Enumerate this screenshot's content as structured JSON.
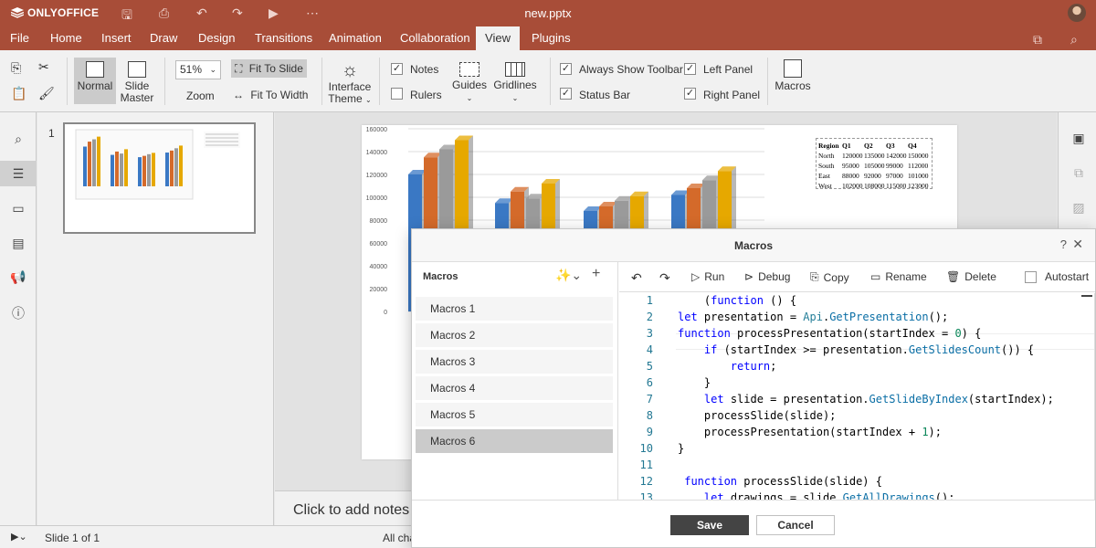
{
  "app": {
    "logo_text": "ONLYOFFICE",
    "doc_title": "new.pptx"
  },
  "menu": {
    "items": [
      "File",
      "Home",
      "Insert",
      "Draw",
      "Design",
      "Transitions",
      "Animation",
      "Collaboration",
      "View",
      "Plugins"
    ],
    "active": "View"
  },
  "toolbar": {
    "normal_label": "Normal",
    "slide_master_label": [
      "Slide",
      "Master"
    ],
    "zoom_value": "51%",
    "zoom_label": "Zoom",
    "fit_to_slide": "Fit To Slide",
    "fit_to_width": "Fit To Width",
    "interface_theme": [
      "Interface",
      "Theme"
    ],
    "notes": "Notes",
    "rulers": "Rulers",
    "guides": "Guides",
    "gridlines": "Gridlines",
    "always_show_toolbar": "Always Show Toolbar",
    "status_bar": "Status Bar",
    "left_panel": "Left Panel",
    "right_panel": "Right Panel",
    "macros": "Macros",
    "checks": {
      "notes": true,
      "rulers": false,
      "always_show_toolbar": true,
      "status_bar": true,
      "left_panel": true,
      "right_panel": true
    }
  },
  "thumbnail": {
    "number": "1"
  },
  "slide": {
    "chart": {
      "y_ticks": [
        "160000",
        "140000",
        "120000",
        "100000",
        "80000",
        "60000",
        "40000",
        "20000",
        "0"
      ],
      "groups": [
        [
          120000,
          135000,
          142000,
          150000
        ],
        [
          95000,
          105000,
          99000,
          112000
        ],
        [
          88000,
          92000,
          97000,
          101000
        ],
        [
          102000,
          108000,
          115000,
          123000
        ]
      ],
      "colors": [
        "#3a78c4",
        "#d46a2a",
        "#9a9a9a",
        "#e6a800"
      ],
      "ylim": [
        0,
        160000
      ]
    },
    "table": {
      "header": [
        "Region",
        "Q1",
        "Q2",
        "Q3",
        "Q4"
      ],
      "rows": [
        [
          "North",
          "120000",
          "135000",
          "142000",
          "150000"
        ],
        [
          "South",
          "95000",
          "105000",
          "99000",
          "112000"
        ],
        [
          "East",
          "88000",
          "92000",
          "97000",
          "101000"
        ],
        [
          "West",
          "102000",
          "108000",
          "115000",
          "123000"
        ]
      ]
    }
  },
  "notes_placeholder": "Click to add notes",
  "status": {
    "slide_info": "Slide 1 of 1",
    "changes": "All cha"
  },
  "dialog": {
    "title": "Macros",
    "left_title": "Macros",
    "macros": [
      "Macros 1",
      "Macros 2",
      "Macros 3",
      "Macros 4",
      "Macros 5",
      "Macros 6"
    ],
    "selected": "Macros 6",
    "tools": {
      "run": "Run",
      "debug": "Debug",
      "copy": "Copy",
      "rename": "Rename",
      "delete": "Delete",
      "autostart": "Autostart"
    },
    "line_numbers": [
      "1",
      "2",
      "3",
      "4",
      "5",
      "6",
      "7",
      "8",
      "9",
      "10",
      "11",
      "12",
      "13"
    ],
    "code": [
      "    (function () {",
      "let presentation = Api.GetPresentation();",
      "function processPresentation(startIndex = 0) {",
      "    if (startIndex >= presentation.GetSlidesCount()) {",
      "        return;",
      "    }",
      "    let slide = presentation.GetSlideByIndex(startIndex);",
      "    processSlide(slide);",
      "    processPresentation(startIndex + 1);",
      "}",
      "",
      " function processSlide(slide) {",
      "    let drawings = slide.GetAllDrawings();"
    ],
    "save": "Save",
    "cancel": "Cancel"
  }
}
